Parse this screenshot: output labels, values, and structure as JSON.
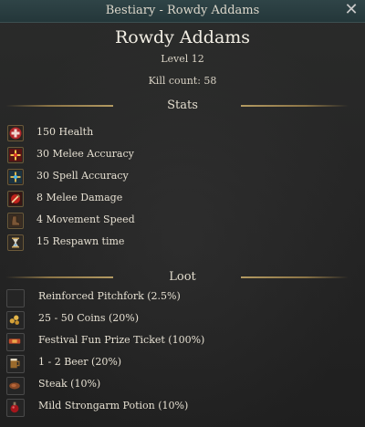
{
  "window": {
    "title": "Bestiary - Rowdy Addams"
  },
  "monster": {
    "name": "Rowdy Addams",
    "level": "Level 12",
    "kill_count": "Kill count: 58"
  },
  "stats": {
    "heading": "Stats",
    "items": [
      {
        "icon": "health-cross-icon",
        "text": "150 Health"
      },
      {
        "icon": "melee-accuracy-icon",
        "text": "30 Melee Accuracy"
      },
      {
        "icon": "spell-accuracy-icon",
        "text": "30 Spell Accuracy"
      },
      {
        "icon": "melee-damage-icon",
        "text": "8 Melee Damage"
      },
      {
        "icon": "boot-icon",
        "text": "4 Movement Speed"
      },
      {
        "icon": "hourglass-icon",
        "text": "15 Respawn time"
      }
    ]
  },
  "loot": {
    "heading": "Loot",
    "items": [
      {
        "icon": "pitchfork-icon",
        "text": "Reinforced Pitchfork (2.5%)"
      },
      {
        "icon": "coins-icon",
        "text": "25 - 50 Coins (20%)"
      },
      {
        "icon": "ticket-icon",
        "text": "Festival Fun Prize Ticket (100%)"
      },
      {
        "icon": "beer-mug-icon",
        "text": "1 - 2 Beer (20%)"
      },
      {
        "icon": "steak-icon",
        "text": "Steak (10%)"
      },
      {
        "icon": "potion-icon",
        "text": "Mild Strongarm Potion (10%)"
      }
    ]
  },
  "colors": {
    "titlebar": "#2a3e41",
    "divider_gold": "#b39a62",
    "text": "#e6e0d2"
  }
}
